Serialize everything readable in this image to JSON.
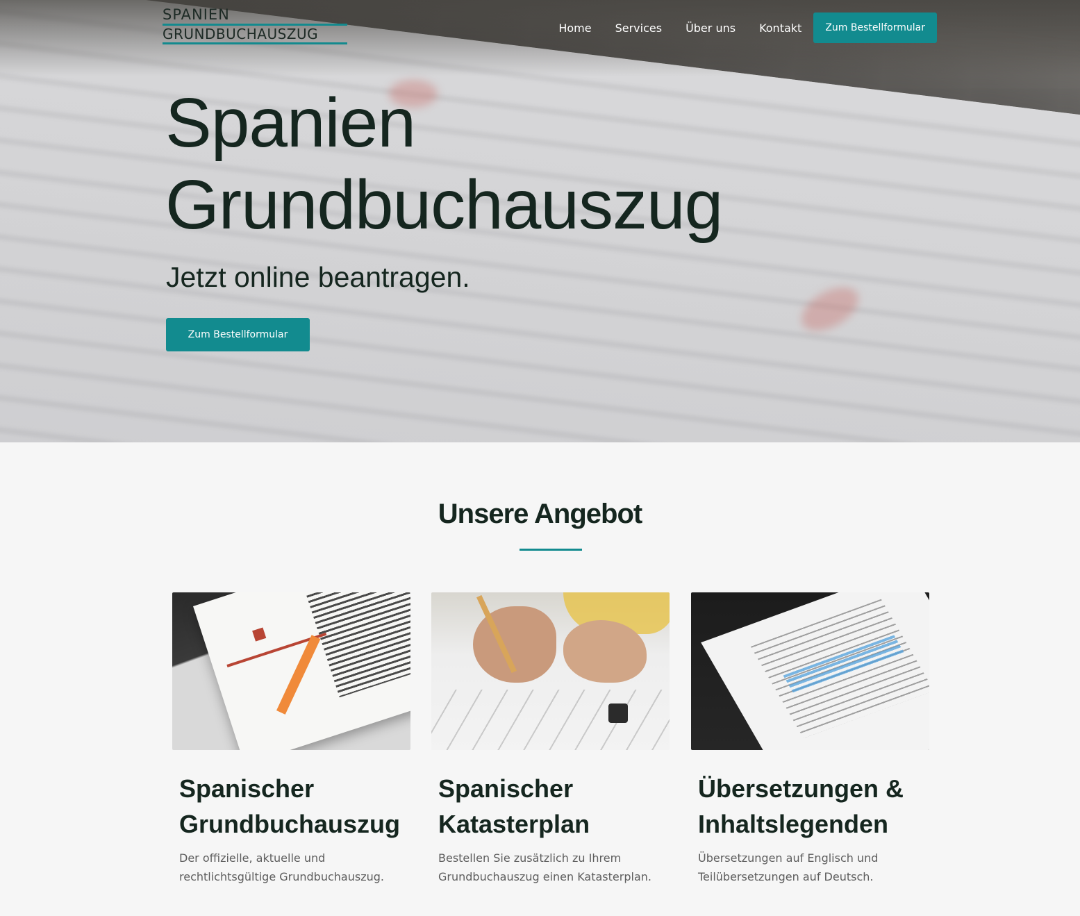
{
  "logo": {
    "line1": "SPANIEN",
    "line2": "GRUNDBUCHAUSZUG"
  },
  "nav": {
    "items": [
      {
        "label": "Home"
      },
      {
        "label": "Services"
      },
      {
        "label": "Über uns"
      },
      {
        "label": "Kontakt"
      }
    ],
    "cta": "Zum Bestellformular"
  },
  "hero": {
    "title_line1": "Spanien",
    "title_line2": "Grundbuchauszug",
    "subtitle": "Jetzt online beantragen.",
    "cta": "Zum Bestellformular"
  },
  "offers": {
    "title": "Unsere Angebot",
    "cards": [
      {
        "title_line1": "Spanischer",
        "title_line2": "Grundbuchauszug",
        "text_line1": "Der offizielle, aktuelle und",
        "text_line2": "rechtlichtsgültige Grundbuchauszug."
      },
      {
        "title_line1": "Spanischer",
        "title_line2": "Katasterplan",
        "text_line1": "Bestellen Sie zusätzlich zu Ihrem",
        "text_line2": "Grundbuchauszug einen Katasterplan."
      },
      {
        "title_line1": "Übersetzungen &",
        "title_line2": "Inhaltslegenden",
        "text_line1": "Übersetzungen auf Englisch und",
        "text_line2": "Teilübersetzungen auf Deutsch."
      }
    ]
  },
  "colors": {
    "accent": "#128b8f",
    "heading": "#15261f",
    "body_text": "#5d5d5d",
    "background": "#f6f6f6"
  }
}
